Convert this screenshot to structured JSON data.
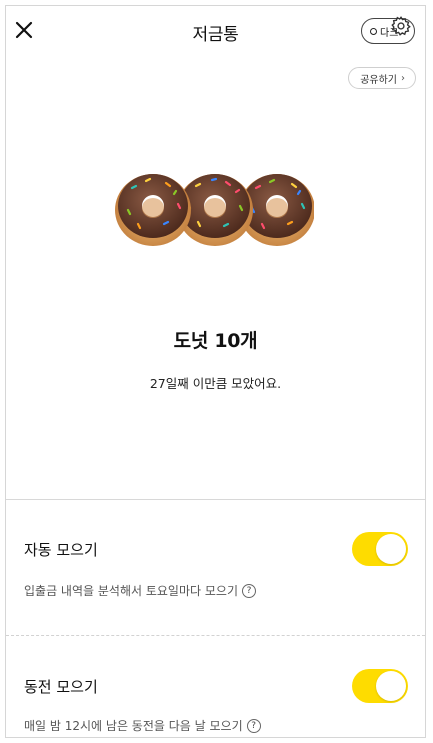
{
  "header": {
    "title": "저금통",
    "dark_mode_label": "다크",
    "share_label": "공유하기",
    "share_chevron": "›"
  },
  "savings": {
    "item_count": "도넛 10개",
    "days_message": "27일째 이만큼 모았어요.",
    "donut_icons": [
      "donut-icon",
      "donut-icon",
      "donut-icon"
    ]
  },
  "options": [
    {
      "title": "자동 모으기",
      "description": "입출금 내역을 분석해서 토요일마다 모으기",
      "enabled": true
    },
    {
      "title": "동전 모으기",
      "description": "매일 밤 12시에 남은 동전을 다음 날 모으기",
      "enabled": true
    }
  ],
  "help_glyph": "?",
  "colors": {
    "toggle_on": "#fedc00",
    "donut_frosting": "#6b3d2c",
    "donut_dough": "#d99a55"
  }
}
